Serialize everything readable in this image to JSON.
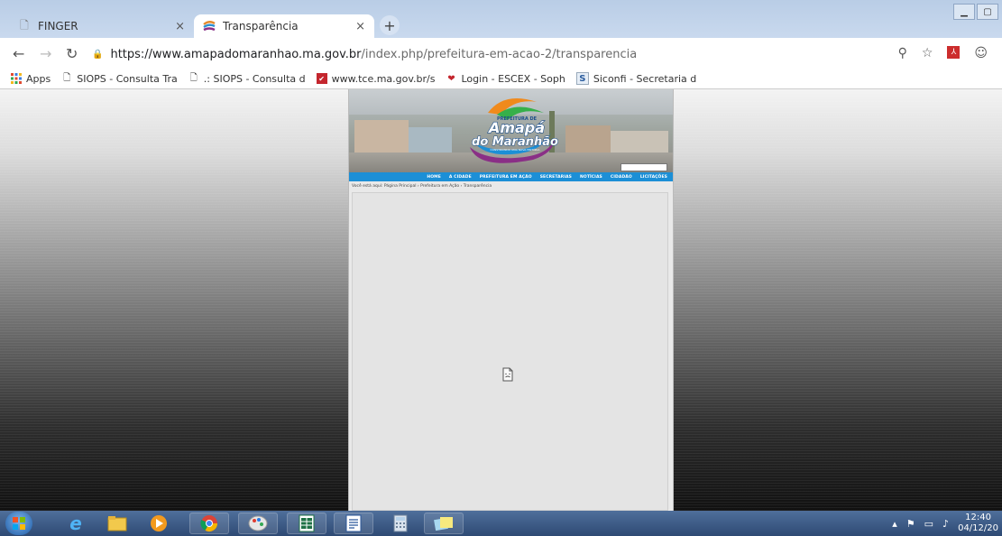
{
  "browser": {
    "tabs": [
      {
        "title": "FINGER",
        "active": false
      },
      {
        "title": "Transparência",
        "active": true
      }
    ],
    "new_tab_label": "+",
    "close_glyph": "×",
    "url_host": "https://www.amapadomaranhao.ma.gov.br",
    "url_path": "/index.php/prefeitura-em-acao-2/transparencia",
    "bookmarks": [
      {
        "label": "Apps",
        "icon": "apps-grid-icon"
      },
      {
        "label": "SIOPS - Consulta Tra",
        "icon": "page-icon"
      },
      {
        "label": ".: SIOPS - Consulta d",
        "icon": "page-icon"
      },
      {
        "label": "www.tce.ma.gov.br/s",
        "icon": "tce-icon"
      },
      {
        "label": "Login - ESCEX - Soph",
        "icon": "book-icon"
      },
      {
        "label": "Siconfi - Secretaria d",
        "icon": "siconfi-icon"
      }
    ]
  },
  "site": {
    "logo_top": "PREFEITURA DE",
    "logo_line1": "Amapá",
    "logo_line2": "do Maranhão",
    "logo_slogan": "CONSTRUINDO UMA NOVA HISTÓRIA",
    "menu": [
      "HOME",
      "A CIDADE",
      "PREFEITURA EM AÇÃO",
      "SECRETARIAS",
      "NOTÍCIAS",
      "CIDADÃO",
      "LICITAÇÕES"
    ],
    "breadcrumb": "Você está aqui: Página Principal › Prefeitura em Ação › Transparência"
  },
  "taskbar": {
    "time": "12:40",
    "date": "04/12/20"
  },
  "colors": {
    "menu_blue": "#1c8fd6",
    "taskbar": "#2e4a74"
  }
}
